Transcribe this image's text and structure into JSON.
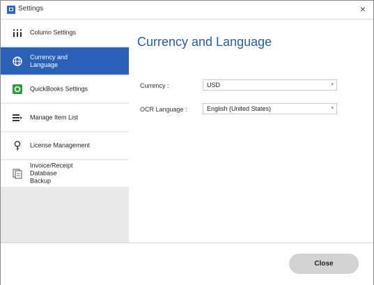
{
  "window": {
    "title": "Settings",
    "close_glyph": "×"
  },
  "sidebar": {
    "items": [
      {
        "label": "Column Settings",
        "icon": "column-settings-icon"
      },
      {
        "label": "Currency and Language",
        "icon": "globe-icon",
        "active": true
      },
      {
        "label": "QuickBooks Settings",
        "icon": "quickbooks-icon"
      },
      {
        "label": "Manage Item List",
        "icon": "list-icon"
      },
      {
        "label": "License Management",
        "icon": "key-icon"
      },
      {
        "label": "Invoice/Receipt Database Backup",
        "icon": "database-backup-icon"
      }
    ]
  },
  "main": {
    "title": "Currency and Language",
    "currency": {
      "label": "Currency :",
      "value": "USD"
    },
    "ocr_language": {
      "label": "OCR Language :",
      "value": "English (United States)"
    }
  },
  "footer": {
    "close_label": "Close"
  },
  "colors": {
    "accent": "#2a60b6",
    "title_blue": "#2a5ca8",
    "quickbooks_green": "#2e9e3a"
  }
}
